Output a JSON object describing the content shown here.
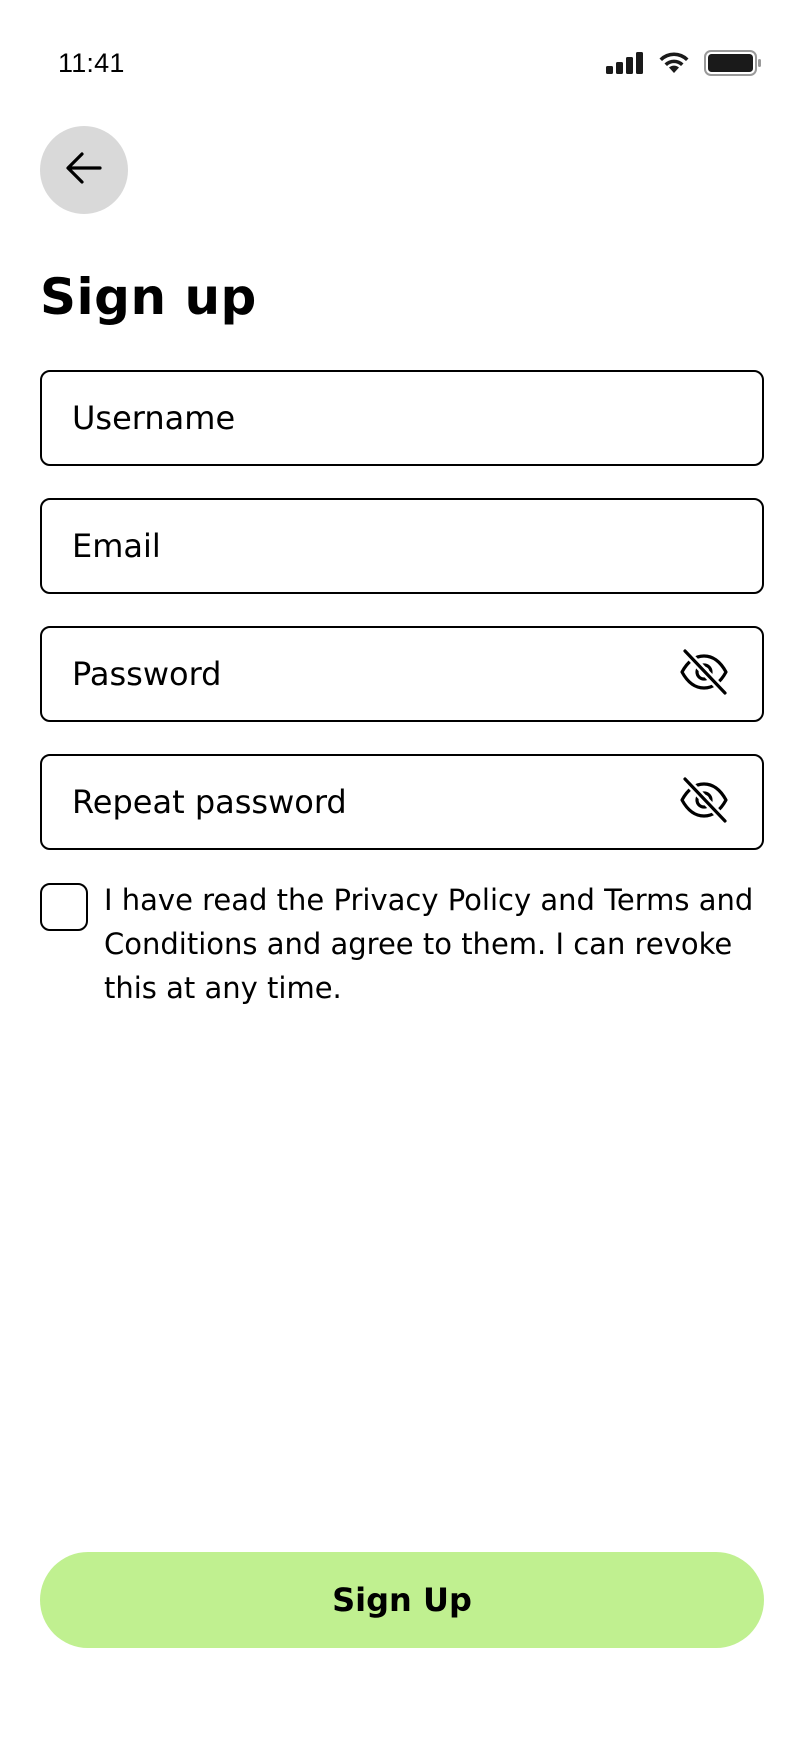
{
  "status_bar": {
    "time": "11:41",
    "icons": [
      "cellular-signal-icon",
      "wifi-icon",
      "battery-icon"
    ]
  },
  "header": {
    "back_icon": "arrow-left-icon",
    "title": "Sign up"
  },
  "form": {
    "username": {
      "placeholder": "Username",
      "value": ""
    },
    "email": {
      "placeholder": "Email",
      "value": ""
    },
    "password": {
      "placeholder": "Password",
      "value": "",
      "toggle_icon": "eye-off-icon"
    },
    "repeat_password": {
      "placeholder": "Repeat password",
      "value": "",
      "toggle_icon": "eye-off-icon"
    }
  },
  "consent": {
    "checked": false,
    "text": "I have read the Privacy Policy and Terms and Conditions and agree to them. I can revoke this at any time."
  },
  "actions": {
    "signup_label": "Sign Up"
  },
  "colors": {
    "primary_button": "#c0f090",
    "back_button_bg": "#d9d9d9",
    "border": "#000000"
  }
}
